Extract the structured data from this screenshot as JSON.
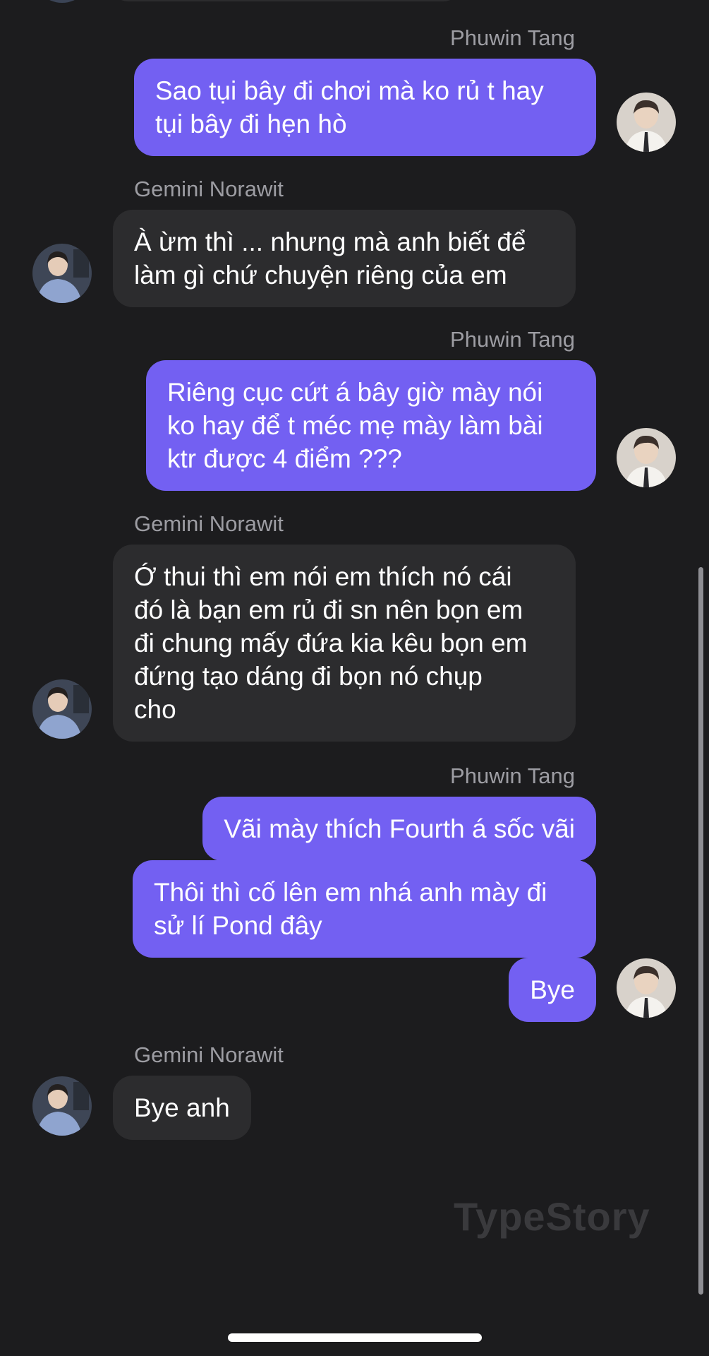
{
  "colors": {
    "background": "#1c1c1e",
    "outgoing_bubble": "#7360f2",
    "incoming_bubble": "#2c2c2e",
    "sender_name": "#9d9da3",
    "watermark": "#3a3a3d"
  },
  "senders": {
    "me": "Phuwin Tang",
    "them": "Gemini Norawit"
  },
  "messages": [
    {
      "sender": "Phuwin Tang",
      "text": "Sao tụi bây đi chơi mà ko rủ t hay\ntụi bây đi hẹn hò"
    },
    {
      "sender": "Gemini Norawit",
      "text": "À ừm thì ... nhưng mà anh biết để\nlàm gì chứ chuyện riêng của em"
    },
    {
      "sender": "Phuwin Tang",
      "text": "Riêng cục cứt á bây giờ mày nói\nko hay để t méc mẹ mày làm bài\nktr được 4 điểm ???"
    },
    {
      "sender": "Gemini Norawit",
      "text": "Ớ thui thì em nói em thích nó cái\nđó là bạn em rủ đi sn nên bọn em\nđi chung mấy đứa kia kêu bọn em\nđứng tạo dáng đi bọn nó chụp\ncho"
    },
    {
      "sender": "Phuwin Tang",
      "text": "Vãi mày thích Fourth á sốc vãi"
    },
    {
      "sender": "Phuwin Tang",
      "text": "Thôi thì cố lên em nhá anh mày đi\nsử lí Pond đây"
    },
    {
      "sender": "Phuwin Tang",
      "text": "Bye"
    },
    {
      "sender": "Gemini Norawit",
      "text": "Bye anh"
    }
  ],
  "watermark": "TypeStory"
}
